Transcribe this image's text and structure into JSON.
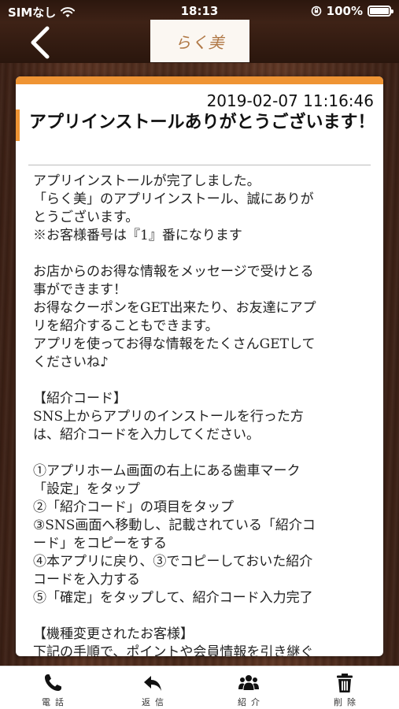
{
  "status_bar": {
    "carrier": "SIMなし",
    "time": "18:13",
    "battery": "100%"
  },
  "header": {
    "logo_text": "らく美"
  },
  "message": {
    "timestamp": "2019-02-07 11:16:46",
    "title": "アプリインストールありがとうございます！",
    "body_lines": [
      "アプリインストールが完了しました。",
      " 「らく美」のアプリインストール、誠にありが",
      "とうございます。",
      "※お客様番号は『1』番になります",
      "",
      " お店からのお得な情報をメッセージで受けとる",
      "事ができます！",
      " お得なクーポンをGET出来たり、お友達にアプ",
      "リを紹介することもできます。",
      " アプリを使ってお得な情報をたくさんGETして",
      "くださいね♪",
      "",
      "【紹介コード】",
      "SNS上からアプリのインストールを行った方",
      "は、紹介コードを入力してください。",
      "",
      "①アプリホーム画面の右上にある歯車マーク",
      "「設定」をタップ",
      "②「紹介コード」の項目をタップ",
      "③SNS画面へ移動し、記載されている「紹介コ",
      "ード」をコピーをする",
      "④本アプリに戻り、③でコピーしておいた紹介",
      "コードを入力する",
      "⑤「確定」をタップして、紹介コード入力完了",
      "",
      "【機種変更されたお客様】",
      "下記の手順で、ポイントや会員情報を引き継ぐ"
    ]
  },
  "bottom_nav": {
    "items": [
      {
        "label": "電話",
        "icon": "phone-icon"
      },
      {
        "label": "返信",
        "icon": "reply-icon"
      },
      {
        "label": "紹介",
        "icon": "users-icon"
      },
      {
        "label": "削除",
        "icon": "trash-icon"
      }
    ]
  },
  "colors": {
    "accent": "#ef9434",
    "wood_dark": "#3a1f14",
    "logo": "#b07846"
  }
}
